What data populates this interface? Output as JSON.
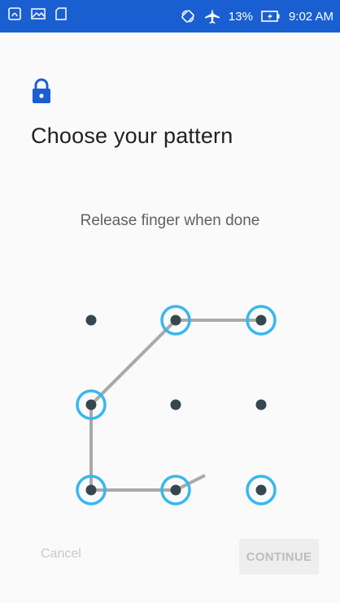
{
  "status_bar": {
    "left_icons": [
      "nfc-icon",
      "image-icon",
      "sd-card-icon"
    ],
    "right_icons": [
      "rotate-icon",
      "airplane-icon",
      "battery-charging-icon"
    ],
    "battery": "13%",
    "time": "9:02 AM",
    "background": "#1a5fd1"
  },
  "header": {
    "icon": "lock-icon",
    "title": "Choose your pattern"
  },
  "instruction": "Release finger when done",
  "pattern": {
    "dot_color": "#37474f",
    "ring_color": "#35b8f0",
    "line_color": "#a9a9a9",
    "selected_nodes": [
      1,
      2,
      3,
      6,
      7,
      8
    ],
    "draw_order": [
      2,
      1,
      3,
      6,
      7
    ]
  },
  "actions": {
    "cancel_label": "Cancel",
    "continue_label": "CONTINUE"
  }
}
